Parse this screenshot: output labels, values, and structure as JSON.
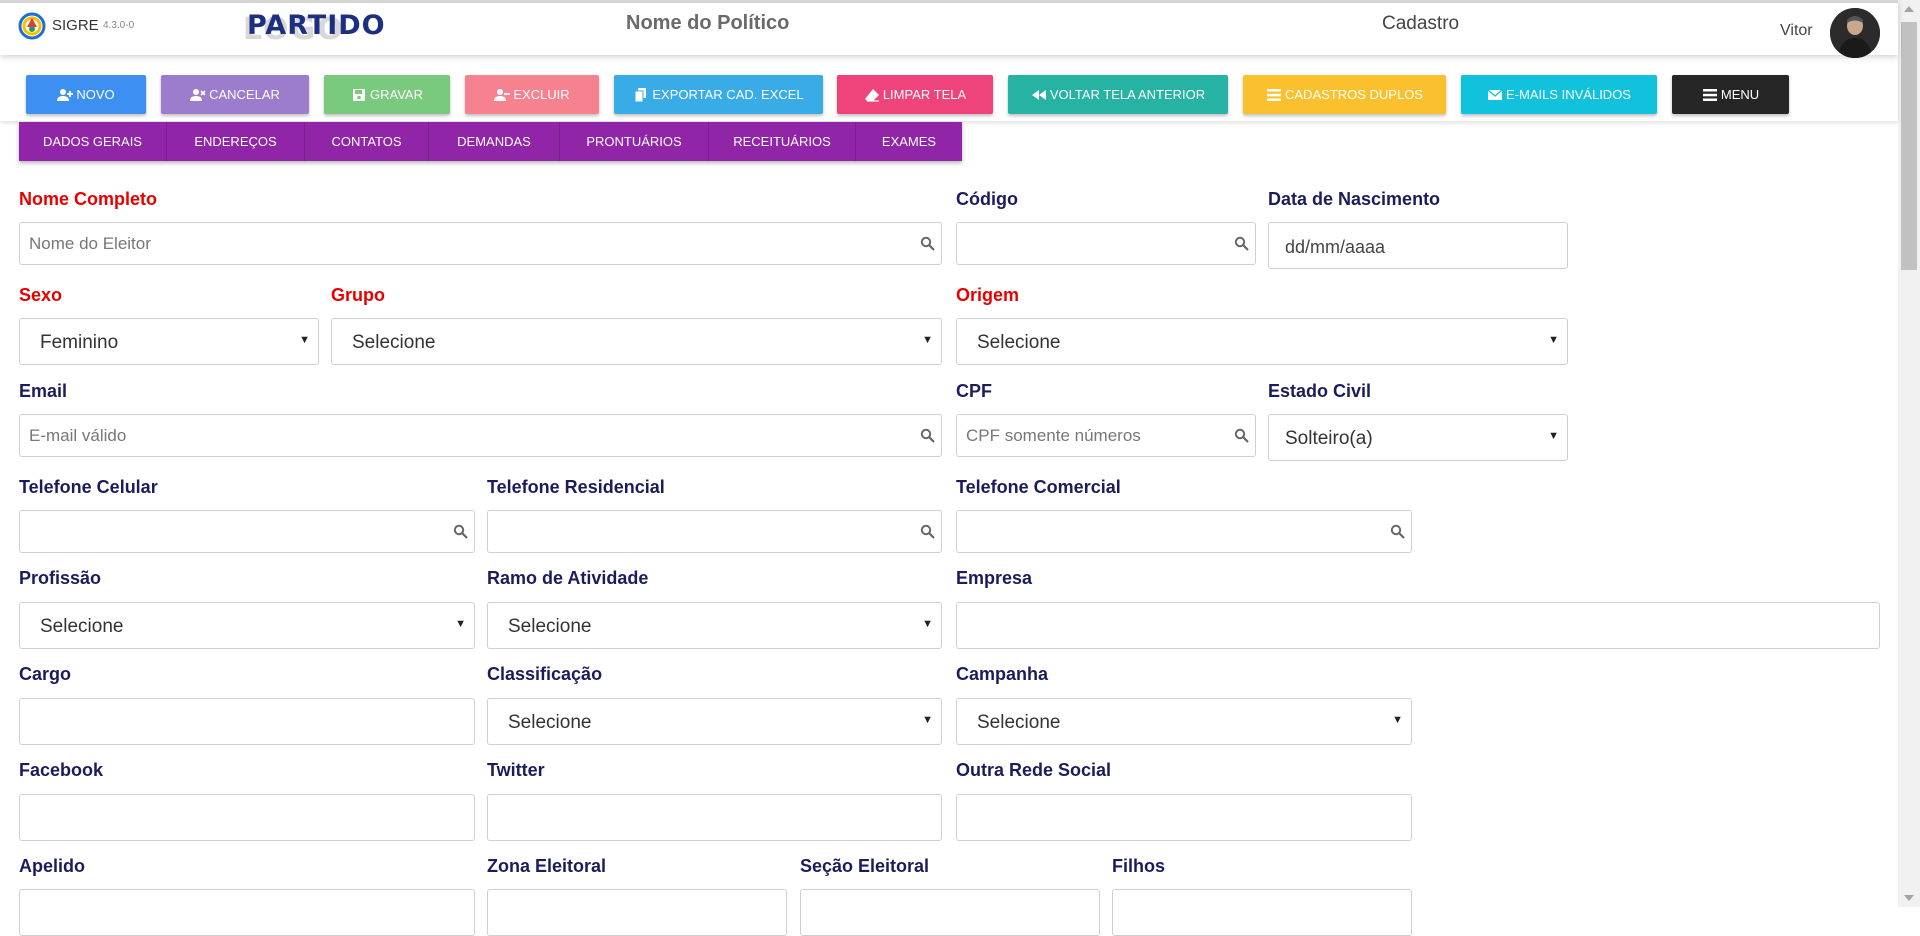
{
  "header": {
    "app_name": "SIGRE",
    "version": "4.3.0-0",
    "party_logo_text": "PARTIDO",
    "politician": "Nome do Político",
    "section": "Cadastro",
    "user": "Vitor"
  },
  "toolbar": {
    "buttons": [
      {
        "label": "NOVO",
        "color": "#3d8ff2",
        "icon": "user-plus-icon"
      },
      {
        "label": "CANCELAR",
        "color": "#9c7ccc",
        "icon": "user-times-icon"
      },
      {
        "label": "GRAVAR",
        "color": "#79c97e",
        "icon": "floppy-disk-icon"
      },
      {
        "label": "EXCLUIR",
        "color": "#f7828f",
        "icon": "user-minus-icon"
      },
      {
        "label": "EXPORTAR CAD. EXCEL",
        "color": "#39ace8",
        "icon": "copy-icon"
      },
      {
        "label": "LIMPAR TELA",
        "color": "#ee437b",
        "icon": "eraser-icon"
      },
      {
        "label": "VOLTAR TELA ANTERIOR",
        "color": "#27b3a3",
        "icon": "backward-icon"
      },
      {
        "label": "CADASTROS DUPLOS",
        "color": "#fbc02d",
        "icon": "list-icon"
      },
      {
        "label": "E-MAILS INVÁLIDOS",
        "color": "#12c1dc",
        "icon": "envelope-icon"
      },
      {
        "label": "MENU",
        "color": "#262626",
        "icon": "menu-icon"
      }
    ]
  },
  "tabs": [
    "DADOS GERAIS",
    "ENDEREÇOS",
    "CONTATOS",
    "DEMANDAS",
    "PRONTUÁRIOS",
    "RECEITUÁRIOS",
    "EXAMES"
  ],
  "form": {
    "nome_completo": {
      "label": "Nome Completo",
      "placeholder": "Nome do Eleitor"
    },
    "codigo": {
      "label": "Código",
      "placeholder": ""
    },
    "data_nascimento": {
      "label": "Data de Nascimento",
      "value": "dd/mm/aaaa"
    },
    "sexo": {
      "label": "Sexo",
      "value": "Feminino"
    },
    "grupo": {
      "label": "Grupo",
      "value": "Selecione"
    },
    "origem": {
      "label": "Origem",
      "value": "Selecione"
    },
    "email": {
      "label": "Email",
      "placeholder": "E-mail válido"
    },
    "cpf": {
      "label": "CPF",
      "placeholder": "CPF somente números"
    },
    "estado_civil": {
      "label": "Estado Civil",
      "value": "Solteiro(a)"
    },
    "tel_celular": {
      "label": "Telefone Celular",
      "placeholder": ""
    },
    "tel_residencial": {
      "label": "Telefone Residencial",
      "placeholder": ""
    },
    "tel_comercial": {
      "label": "Telefone Comercial",
      "placeholder": ""
    },
    "profissao": {
      "label": "Profissão",
      "value": "Selecione"
    },
    "ramo": {
      "label": "Ramo de Atividade",
      "value": "Selecione"
    },
    "empresa": {
      "label": "Empresa",
      "placeholder": ""
    },
    "cargo": {
      "label": "Cargo",
      "placeholder": ""
    },
    "classificacao": {
      "label": "Classificação",
      "value": "Selecione"
    },
    "campanha": {
      "label": "Campanha",
      "value": "Selecione"
    },
    "facebook": {
      "label": "Facebook",
      "placeholder": ""
    },
    "twitter": {
      "label": "Twitter",
      "placeholder": ""
    },
    "outra_rede": {
      "label": "Outra Rede Social",
      "placeholder": ""
    },
    "apelido": {
      "label": "Apelido"
    },
    "zona": {
      "label": "Zona Eleitoral"
    },
    "secao": {
      "label": "Seção Eleitoral"
    },
    "filhos": {
      "label": "Filhos"
    }
  },
  "colors": {
    "required_label": "#e60000",
    "label": "#1c1c5c",
    "tabs_bg": "#9025a7"
  }
}
